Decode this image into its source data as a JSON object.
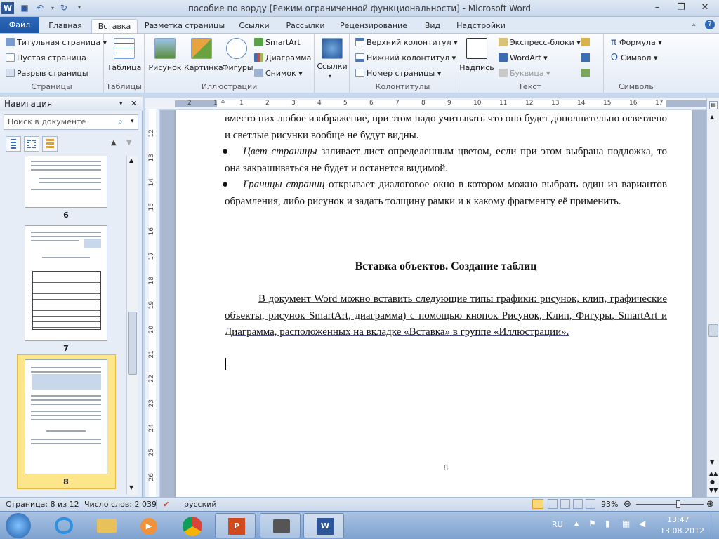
{
  "window": {
    "title": "пособие по ворду [Режим ограниченной функциональности]  -  Microsoft Word",
    "app_icon": "word-icon"
  },
  "tabs": {
    "file": "Файл",
    "items": [
      "Главная",
      "Вставка",
      "Разметка страницы",
      "Ссылки",
      "Рассылки",
      "Рецензирование",
      "Вид",
      "Надстройки"
    ],
    "active": "Вставка"
  },
  "ribbon": {
    "pages": {
      "label": "Страницы",
      "items": [
        "Титульная страница",
        "Пустая страница",
        "Разрыв страницы"
      ]
    },
    "tables": {
      "label": "Таблицы",
      "button": "Таблица"
    },
    "illustrations": {
      "label": "Иллюстрации",
      "buttons": [
        "Рисунок",
        "Картинка",
        "Фигуры"
      ],
      "items": [
        "SmartArt",
        "Диаграмма",
        "Снимок"
      ]
    },
    "links": {
      "label": "",
      "button": "Ссылки"
    },
    "header_footer": {
      "label": "Колонтитулы",
      "items": [
        "Верхний колонтитул",
        "Нижний колонтитул",
        "Номер страницы"
      ]
    },
    "text": {
      "label": "Текст",
      "button": "Надпись",
      "items": [
        "Экспресс-блоки",
        "WordArt",
        "Буквица"
      ]
    },
    "symbols": {
      "label": "Символы",
      "items": [
        "Формула",
        "Символ"
      ]
    }
  },
  "nav": {
    "title": "Навигация",
    "search_placeholder": "Поиск в документе",
    "pages": [
      "6",
      "7",
      "8"
    ],
    "active_page": "8"
  },
  "ruler": {
    "h": [
      "2",
      "1",
      "1",
      "2",
      "3",
      "4",
      "5",
      "6",
      "7",
      "8",
      "9",
      "10",
      "11",
      "12",
      "13",
      "14",
      "15",
      "16",
      "17"
    ],
    "v": [
      "12",
      "13",
      "14",
      "15",
      "16",
      "17",
      "18",
      "19",
      "20",
      "21",
      "22",
      "23",
      "24",
      "25",
      "26"
    ]
  },
  "document": {
    "para1": "вместо них любое изображение, при этом надо учитывать что оно будет дополнительно осветлено и светлые рисунки вообще не будут видны.",
    "bullet1_italic": "Цвет страницы",
    "bullet1_rest": " заливает лист определенным цветом, если при этом выбрана подложка, то она закрашиваться не будет и останется видимой.",
    "bullet2_italic": "Границы страниц",
    "bullet2_rest": " открывает диалоговое окно в котором можно выбрать один из вариантов обрамления, либо рисунок и задать толщину рамки и к какому фрагменту её применить.",
    "heading": "Вставка объектов.  Создание таблиц",
    "para2": "В документ Word  можно вставить следующие типы графики: рисунок, клип, графические объекты, рисунок SmartArt, диаграмма) с помощью кнопок Рисунок, Клип, Фигуры, SmartArt и Диаграмма, расположенных на вкладке «Вставка» в группе «Иллюстрации».",
    "page_number": "8"
  },
  "status": {
    "page": "Страница: 8 из 12",
    "words": "Число слов: 2 039",
    "language": "русский",
    "zoom": "93%",
    "zoom_fraction": 0.62
  },
  "taskbar": {
    "lang": "RU",
    "time": "13:47",
    "date": "13.08.2012"
  }
}
